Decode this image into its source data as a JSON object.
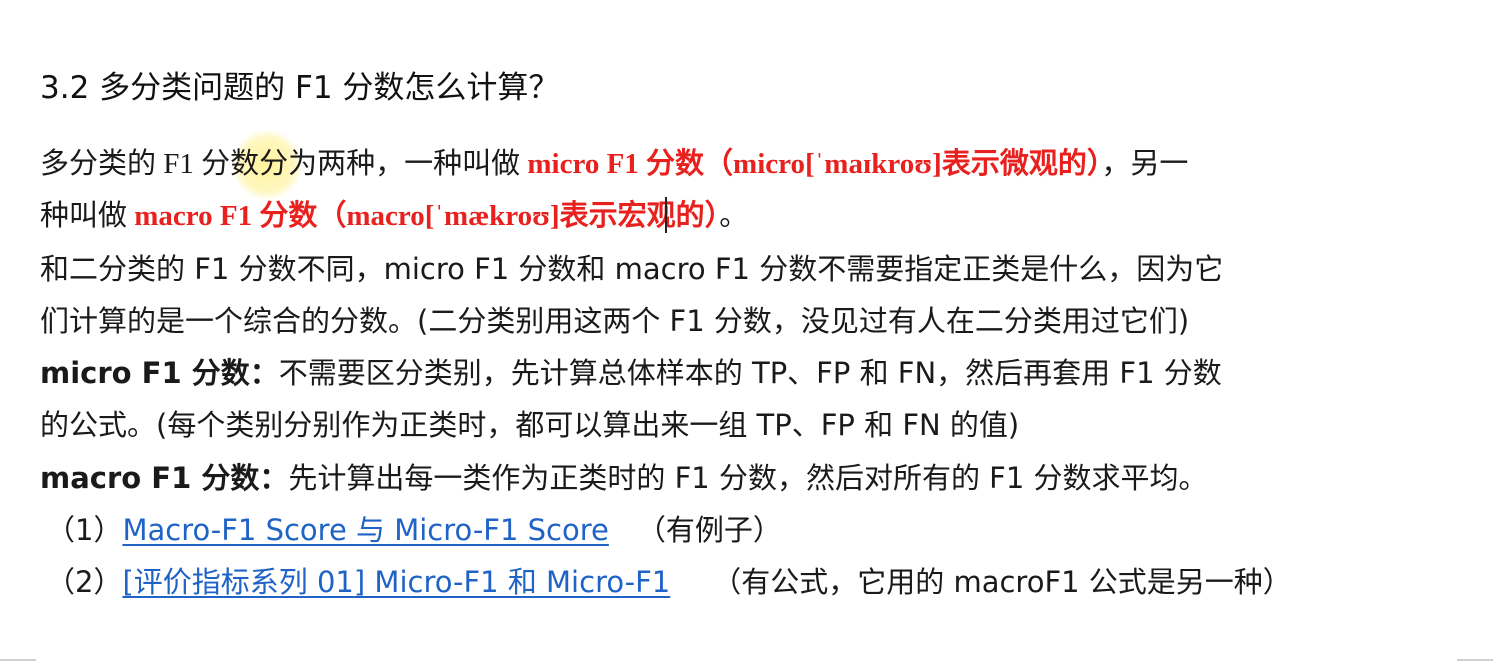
{
  "heading": "3.2 多分类问题的 F1 分数怎么计算？",
  "para1": {
    "l1_a": "多分类的 F1 分数分为两种，一种叫做 ",
    "l1_red": "micro F1 分数（micro[ˈmaɪkroʊ]表示微观的）",
    "l1_b": "，另一",
    "l2_a": "种叫做 ",
    "l2_red": "macro F1 分数（macro[ˈmækroʊ]表示宏观的）",
    "l2_b": "。"
  },
  "para2": {
    "l1": "和二分类的 F1 分数不同，micro  F1 分数和 macro  F1 分数不需要指定正类是什么，因为它",
    "l2": "们计算的是一个综合的分数。(二分类别用这两个  F1  分数，没见过有人在二分类用过它们)"
  },
  "micro": {
    "label": "micro  F1 分数：",
    "l1": "不需要区分类别，先计算总体样本的 TP、FP 和 FN，然后再套用 F1 分数",
    "l2": "的公式。(每个类别分别作为正类时，都可以算出来一组 TP、FP 和 FN 的值)"
  },
  "macro": {
    "label": "macro F1 分数：",
    "text": "先计算出每一类作为正类时的 F1 分数，然后对所有的 F1 分数求平均。"
  },
  "refs": [
    {
      "num": "（1）",
      "link": "Macro-F1 Score 与 Micro-F1 Score",
      "note": "（有例子）"
    },
    {
      "num": "（2）",
      "link": "[评价指标系列 01]  Micro-F1 和 Micro-F1",
      "note": "（有公式，它用的 macroF1 公式是另一种）"
    }
  ],
  "colors": {
    "emphasis": "#e8211f",
    "link": "#1f63c6",
    "highlight": "#ffee78"
  }
}
